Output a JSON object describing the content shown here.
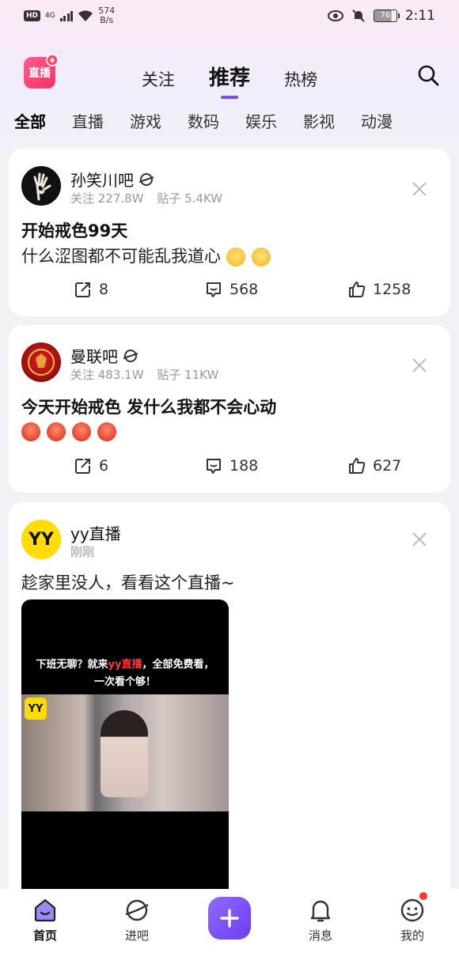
{
  "status_bar": {
    "hd": "HD",
    "network": "4G",
    "speed_value": "574",
    "speed_unit": "B/s",
    "battery": "76",
    "time": "2:11"
  },
  "top_nav": {
    "logo_text": "直播",
    "tabs": [
      {
        "label": "关注",
        "active": false
      },
      {
        "label": "推荐",
        "active": true
      },
      {
        "label": "热榜",
        "active": false
      }
    ]
  },
  "categories": [
    "全部",
    "直播",
    "游戏",
    "数码",
    "娱乐",
    "影视",
    "动漫"
  ],
  "posts": [
    {
      "forum": "孙笑川吧",
      "followers": "关注 227.8W",
      "threads": "贴子 5.4KW",
      "title": "开始戒色99天",
      "text": "什么涩图都不可能乱我道心",
      "shares": "8",
      "comments": "568",
      "likes": "1258"
    },
    {
      "forum": "曼联吧",
      "followers": "关注 483.1W",
      "threads": "贴子 11KW",
      "title": "今天开始戒色 发什么我都不会心动",
      "shares": "6",
      "comments": "188",
      "likes": "627"
    },
    {
      "forum": "yy直播",
      "time": "刚刚",
      "text": "趁家里没人，看看这个直播~",
      "logo_text": "YY",
      "video_caption_1": "下班无聊？就来",
      "video_caption_hl": "yy直播",
      "video_caption_2": "，全部免费看，",
      "video_caption_3": "一次看个够！"
    }
  ],
  "bottom_nav": {
    "home": "首页",
    "forums": "进吧",
    "messages": "消息",
    "mine": "我的"
  },
  "colors": {
    "accent": "#7b4cf5",
    "notification": "#ff3b30"
  }
}
